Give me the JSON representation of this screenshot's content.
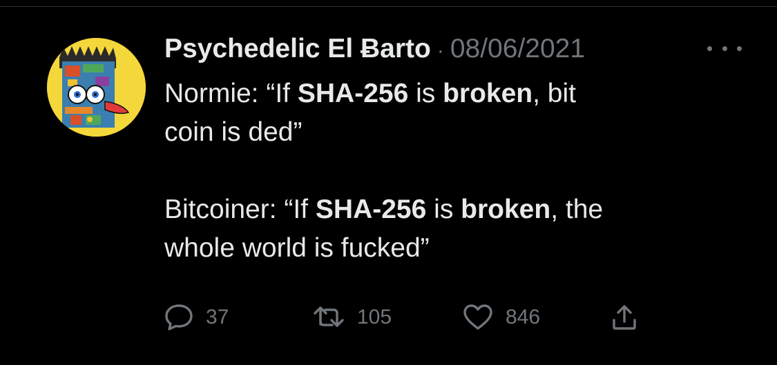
{
  "tweet": {
    "author_name": "Psychedelic El Ƀarto",
    "separator": "·",
    "date": "08/06/2021",
    "line1_pre": "Normie: “If ",
    "line1_bold1": "SHA-256",
    "line1_mid": " is ",
    "line1_bold2": "broken",
    "line1_post": ", bit",
    "line2": "coin is ded”",
    "line3_pre": "Bitcoiner: “If ",
    "line3_bold1": "SHA-256",
    "line3_mid": " is ",
    "line3_bold2": "broken",
    "line3_post": ", the",
    "line4": "whole world is fucked”"
  },
  "actions": {
    "reply_count": "37",
    "retweet_count": "105",
    "like_count": "846"
  },
  "icons": {
    "reply": "reply-icon",
    "retweet": "retweet-icon",
    "like": "heart-icon",
    "share": "share-icon",
    "more": "more-icon"
  },
  "colors": {
    "background": "#000000",
    "text_primary": "#e7e9ea",
    "text_secondary": "#71767b",
    "avatar_background": "#f4d73a"
  }
}
